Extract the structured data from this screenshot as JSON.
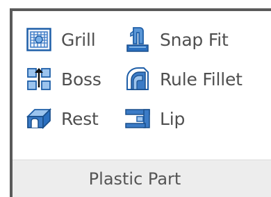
{
  "panel": {
    "title": "Plastic Part",
    "tools": [
      {
        "label": "Grill",
        "icon": "grill-icon"
      },
      {
        "label": "Snap Fit",
        "icon": "snap-fit-icon"
      },
      {
        "label": "Boss",
        "icon": "boss-icon"
      },
      {
        "label": "Rule Fillet",
        "icon": "rule-fillet-icon"
      },
      {
        "label": "Rest",
        "icon": "rest-icon"
      },
      {
        "label": "Lip",
        "icon": "lip-icon"
      }
    ]
  },
  "colors": {
    "panel_border": "#5a5a5a",
    "footer_bg": "#ededed",
    "icon_blue": "#1f5fa8"
  }
}
